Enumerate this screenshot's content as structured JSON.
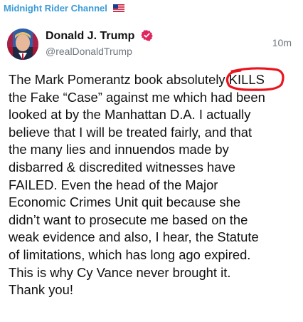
{
  "channel": {
    "name": "Midnight Rider Channel",
    "flag_icon": "us-flag-icon"
  },
  "post": {
    "author_name": "Donald J. Trump",
    "handle": "@realDonaldTrump",
    "time": "10m",
    "verified_icon": "verified-badge-icon",
    "lines": [
      "The Mark Pomerantz book absolutely ",
      "the Fake “Case” against me which had been",
      "looked at by the Manhattan D.A. I actually",
      "believe that I will be treated fairly, and that",
      "the many lies and innuendos made by",
      "disbarred & discredited witnesses have",
      "FAILED. Even the head of the Major",
      "Economic Crimes Unit quit because she",
      "didn’t want to prosecute me based on the",
      "weak evidence and also, I hear, the Statute",
      "of limitations, which has long ago expired.",
      "This is why Cy Vance never brought it.",
      "Thank you!"
    ],
    "highlighted_word": "KILLS"
  },
  "colors": {
    "channel": "#3a9bd7",
    "verified": "#e0245e",
    "annotation": "#e8141e"
  }
}
